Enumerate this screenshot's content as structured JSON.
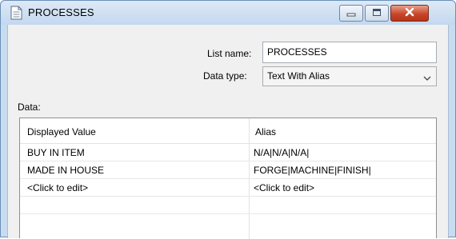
{
  "window": {
    "title": "PROCESSES",
    "minimize_icon": "minimize-icon",
    "maximize_icon": "maximize-icon",
    "close_icon": "close-icon"
  },
  "form": {
    "list_name_label": "List name:",
    "list_name_value": "PROCESSES",
    "data_type_label": "Data type:",
    "data_type_value": "Text With Alias",
    "data_label": "Data:"
  },
  "grid": {
    "columns": [
      "Displayed Value",
      "Alias"
    ],
    "rows": [
      [
        "BUY IN ITEM",
        "N/A|N/A|N/A|"
      ],
      [
        "MADE IN HOUSE",
        "FORGE|MACHINE|FINISH|"
      ],
      [
        "<Click to edit>",
        "<Click to edit>"
      ],
      [
        "",
        ""
      ]
    ]
  },
  "colors": {
    "titlebar": "#c8dcf0",
    "close_button": "#c7472c",
    "client_background": "#f0f0f0"
  }
}
